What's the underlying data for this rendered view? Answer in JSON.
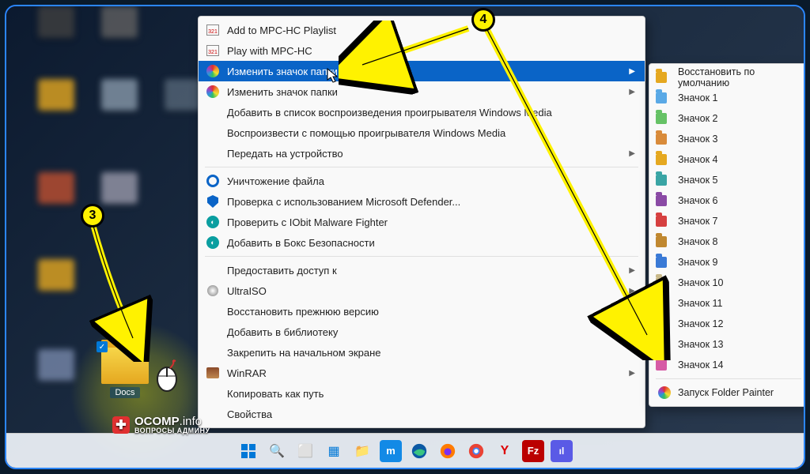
{
  "desktop": {
    "selected_folder_label": "Docs"
  },
  "context_menu": {
    "items": [
      {
        "label": "Add to MPC-HC Playlist",
        "icon": "mpc-playlist-icon",
        "submenu": false
      },
      {
        "label": "Play with MPC-HC",
        "icon": "mpc-play-icon",
        "submenu": false
      },
      {
        "label": "Изменить значок папки",
        "icon": "folderpainter-icon",
        "submenu": true,
        "highlight": true
      },
      {
        "label": "Изменить значок папки",
        "icon": "folderpainter-icon",
        "submenu": true
      },
      {
        "label": "Добавить в список воспроизведения проигрывателя Windows Media",
        "icon": "",
        "submenu": false
      },
      {
        "label": "Воспроизвести с помощью проигрывателя Windows Media",
        "icon": "",
        "submenu": false
      },
      {
        "label": "Передать на устройство",
        "icon": "",
        "submenu": true
      },
      {
        "sep": true
      },
      {
        "label": "Уничтожение файла",
        "icon": "ccleaner-icon",
        "submenu": false
      },
      {
        "label": "Проверка с использованием Microsoft Defender...",
        "icon": "defender-icon",
        "submenu": false
      },
      {
        "label": "Проверить с IObit Malware Fighter",
        "icon": "iobit-icon",
        "submenu": false
      },
      {
        "label": "Добавить в Бокс Безопасности",
        "icon": "iobit-icon",
        "submenu": false
      },
      {
        "sep": true
      },
      {
        "label": "Предоставить доступ к",
        "icon": "",
        "submenu": true
      },
      {
        "label": "UltraISO",
        "icon": "ultraiso-icon",
        "submenu": true
      },
      {
        "label": "Восстановить прежнюю версию",
        "icon": "",
        "submenu": false
      },
      {
        "label": "Добавить в библиотеку",
        "icon": "",
        "submenu": true
      },
      {
        "label": "Закрепить на начальном экране",
        "icon": "",
        "submenu": false
      },
      {
        "label": "WinRAR",
        "icon": "winrar-icon",
        "submenu": true
      },
      {
        "label": "Копировать как путь",
        "icon": "",
        "submenu": false
      },
      {
        "label": "Свойства",
        "icon": "",
        "submenu": false
      }
    ]
  },
  "submenu": {
    "restore_default": "Восстановить по умолчанию",
    "icon_prefix": "Значок",
    "items": [
      {
        "n": "1",
        "c": "#5aa9e6"
      },
      {
        "n": "2",
        "c": "#66c266"
      },
      {
        "n": "3",
        "c": "#d98b3a"
      },
      {
        "n": "4",
        "c": "#e5a820"
      },
      {
        "n": "5",
        "c": "#3aa5a5"
      },
      {
        "n": "6",
        "c": "#8a4aa5"
      },
      {
        "n": "7",
        "c": "#d64040"
      },
      {
        "n": "8",
        "c": "#c08830"
      },
      {
        "n": "9",
        "c": "#3a7ad6"
      },
      {
        "n": "10",
        "c": "#c9b98a"
      },
      {
        "n": "11",
        "c": "#a8a8a8"
      },
      {
        "n": "12",
        "c": "#c0d070"
      },
      {
        "n": "13",
        "c": "#7ab85a"
      },
      {
        "n": "14",
        "c": "#d65aa5"
      }
    ],
    "launch": "Запуск Folder Painter"
  },
  "annotations": {
    "step3": "3",
    "step4": "4"
  },
  "watermark": {
    "brand": "OCOMP",
    "tld": ".info",
    "sub": "ВОПРОСЫ АДМИНУ"
  },
  "taskbar_icons": [
    "start",
    "search",
    "taskview",
    "widgets",
    "explorer",
    "maxthon",
    "edge",
    "firefox",
    "chrome",
    "yandex",
    "filezilla",
    "cpuz"
  ]
}
